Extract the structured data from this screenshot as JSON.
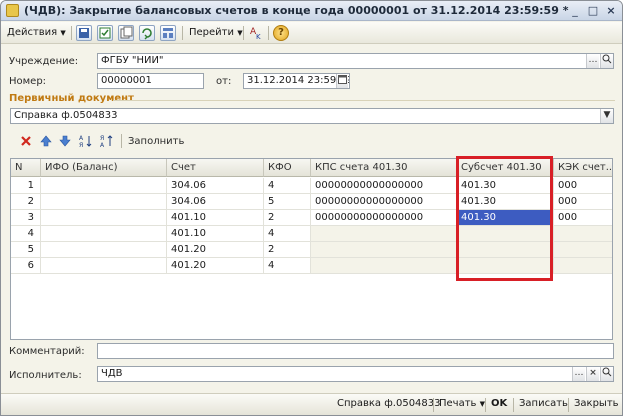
{
  "window": {
    "title": "(ЧДВ): Закрытие балансовых счетов в конце года 00000001 от 31.12.2014 23:59:59 *",
    "minimize": "_",
    "maximize": "□",
    "close": "×"
  },
  "toolbar": {
    "actions_label": "Действия",
    "goto_label": "Перейти",
    "help_label": "?"
  },
  "form": {
    "institution_label": "Учреждение:",
    "institution_value": "ФГБУ \"НИИ\"",
    "number_label": "Номер:",
    "number_value": "00000001",
    "date_label": "от:",
    "date_value": "31.12.2014 23:59:59",
    "primary_doc_title": "Первичный документ",
    "primary_doc_value": "Справка ф.0504833",
    "comment_label": "Комментарий:",
    "comment_value": "",
    "executor_label": "Исполнитель:",
    "executor_value": "ЧДВ"
  },
  "table_toolbar": {
    "fill_label": "Заполнить"
  },
  "table": {
    "columns": [
      "N",
      "ИФО (Баланс)",
      "Счет",
      "КФО",
      "КПС счета 401.30",
      "Субсчет 401.30",
      "КЭК счет..."
    ],
    "rows": [
      {
        "n": "1",
        "ifo": "",
        "account": "304.06",
        "kfo": "4",
        "kps": "00000000000000000",
        "subaccount": "401.30",
        "kek": "000"
      },
      {
        "n": "2",
        "ifo": "",
        "account": "304.06",
        "kfo": "5",
        "kps": "00000000000000000",
        "subaccount": "401.30",
        "kek": "000"
      },
      {
        "n": "3",
        "ifo": "",
        "account": "401.10",
        "kfo": "2",
        "kps": "00000000000000000",
        "subaccount": "401.30",
        "kek": "000"
      },
      {
        "n": "4",
        "ifo": "",
        "account": "401.10",
        "kfo": "4",
        "kps": "",
        "subaccount": "",
        "kek": ""
      },
      {
        "n": "5",
        "ifo": "",
        "account": "401.20",
        "kfo": "2",
        "kps": "",
        "subaccount": "",
        "kek": ""
      },
      {
        "n": "6",
        "ifo": "",
        "account": "401.20",
        "kfo": "4",
        "kps": "",
        "subaccount": "",
        "kek": ""
      }
    ],
    "selected_row": 2,
    "selected_column": "subaccount"
  },
  "statusbar": {
    "doc_label": "Справка ф.0504833",
    "print_label": "Печать",
    "ok_label": "OK",
    "save_label": "Записать",
    "close_label": "Закрыть"
  },
  "colors": {
    "accent_section": "#c07a12",
    "selection": "#3d5cc1",
    "highlight_frame": "#d81f26"
  }
}
